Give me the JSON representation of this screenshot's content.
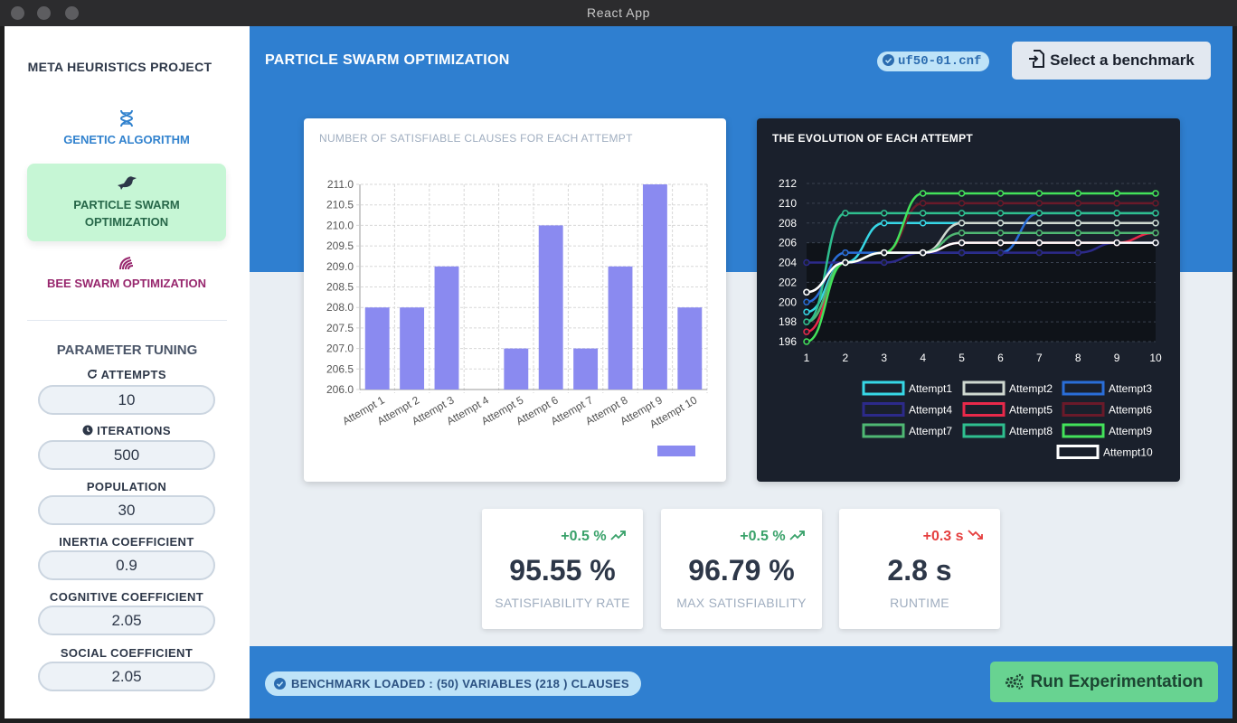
{
  "window": {
    "title": "React App"
  },
  "sidebar": {
    "brand": "META HEURISTICS PROJECT",
    "nav": [
      {
        "label": "GENETIC ALGORITHM",
        "icon": "dna-icon"
      },
      {
        "label": "PARTICLE SWARM OPTIMIZATION",
        "icon": "bird-icon"
      },
      {
        "label": "BEE SWARM OPTIMIZATION",
        "icon": "swarm-icon"
      }
    ],
    "params_title": "PARAMETER TUNING",
    "params": [
      {
        "label": "ATTEMPTS",
        "value": "10",
        "icon": "redo-icon"
      },
      {
        "label": "ITERATIONS",
        "value": "500",
        "icon": "clock-icon"
      },
      {
        "label": "POPULATION",
        "value": "30"
      },
      {
        "label": "INERTIA COEFFICIENT",
        "value": "0.9"
      },
      {
        "label": "COGNITIVE COEFFICIENT",
        "value": "2.05"
      },
      {
        "label": "SOCIAL COEFFICIENT",
        "value": "2.05"
      }
    ]
  },
  "header": {
    "title": "PARTICLE SWARM OPTIMIZATION",
    "file": "uf50-01.cnf",
    "select_button": "Select a benchmark"
  },
  "charts": {
    "bar_title": "NUMBER OF SATISFIABLE CLAUSES FOR EACH ATTEMPT",
    "line_title": "THE EVOLUTION OF EACH ATTEMPT"
  },
  "chart_data": [
    {
      "type": "bar",
      "title": "NUMBER OF SATISFIABLE CLAUSES FOR EACH ATTEMPT",
      "categories": [
        "Attempt 1",
        "Attempt 2",
        "Attempt 3",
        "Attempt 4",
        "Attempt 5",
        "Attempt 6",
        "Attempt 7",
        "Attempt 8",
        "Attempt 9",
        "Attempt 10"
      ],
      "values": [
        208,
        208,
        209,
        206,
        207,
        210,
        207,
        209,
        211,
        208
      ],
      "ylim": [
        206,
        211
      ],
      "yticks": [
        "206.0",
        "206.5",
        "207.0",
        "207.5",
        "208.0",
        "208.5",
        "209.0",
        "209.5",
        "210.0",
        "210.5",
        "211.0"
      ],
      "color": "#8a8af0",
      "grid": true
    },
    {
      "type": "line",
      "title": "THE EVOLUTION OF EACH ATTEMPT",
      "x": [
        1,
        2,
        3,
        4,
        5,
        6,
        7,
        8,
        9,
        10
      ],
      "ylim": [
        196,
        212
      ],
      "yticks": [
        196,
        198,
        200,
        202,
        204,
        206,
        208,
        210,
        212
      ],
      "series": [
        {
          "name": "Attempt1",
          "color": "#37d7e6",
          "values": [
            199,
            204,
            208,
            208,
            208,
            208,
            208,
            208,
            208,
            208
          ]
        },
        {
          "name": "Attempt2",
          "color": "#cfd8d0",
          "values": [
            201,
            204,
            205,
            205,
            208,
            208,
            208,
            208,
            208,
            208
          ]
        },
        {
          "name": "Attempt3",
          "color": "#2a6ed8",
          "values": [
            200,
            205,
            205,
            205,
            205,
            205,
            209,
            209,
            209,
            209
          ]
        },
        {
          "name": "Attempt4",
          "color": "#2c2a8a",
          "values": [
            204,
            204,
            204,
            205,
            205,
            205,
            205,
            205,
            206,
            206
          ]
        },
        {
          "name": "Attempt5",
          "color": "#e8294a",
          "values": [
            197,
            204,
            205,
            205,
            206,
            206,
            206,
            206,
            206,
            207
          ]
        },
        {
          "name": "Attempt6",
          "color": "#6a1a2a",
          "values": [
            198,
            204,
            205,
            210,
            210,
            210,
            210,
            210,
            210,
            210
          ]
        },
        {
          "name": "Attempt7",
          "color": "#4fb873",
          "values": [
            198,
            204,
            205,
            205,
            207,
            207,
            207,
            207,
            207,
            207
          ]
        },
        {
          "name": "Attempt8",
          "color": "#2fbf8f",
          "values": [
            198,
            209,
            209,
            209,
            209,
            209,
            209,
            209,
            209,
            209
          ]
        },
        {
          "name": "Attempt9",
          "color": "#43e25a",
          "values": [
            196,
            204,
            205,
            211,
            211,
            211,
            211,
            211,
            211,
            211
          ]
        },
        {
          "name": "Attempt10",
          "color": "#ffffff",
          "values": [
            201,
            204,
            205,
            205,
            206,
            206,
            206,
            206,
            206,
            206
          ]
        }
      ],
      "legend": "bottom",
      "grid": true
    }
  ],
  "stats": [
    {
      "delta": "+0.5 %",
      "delta_color": "#38a169",
      "value": "95.55 %",
      "label": "SATISFIABILITY RATE",
      "trend_icon": "trend-up-icon"
    },
    {
      "delta": "+0.5 %",
      "delta_color": "#38a169",
      "value": "96.79 %",
      "label": "MAX SATISFIABILITY",
      "trend_icon": "trend-up-icon"
    },
    {
      "delta": "+0.3 s",
      "delta_color": "#e53e3e",
      "value": "2.8 s",
      "label": "RUNTIME",
      "trend_icon": "trend-down-icon"
    }
  ],
  "footer": {
    "status": "BENCHMARK LOADED : (50) VARIABLES (218 ) CLAUSES",
    "run_button": "Run Experimentation"
  }
}
